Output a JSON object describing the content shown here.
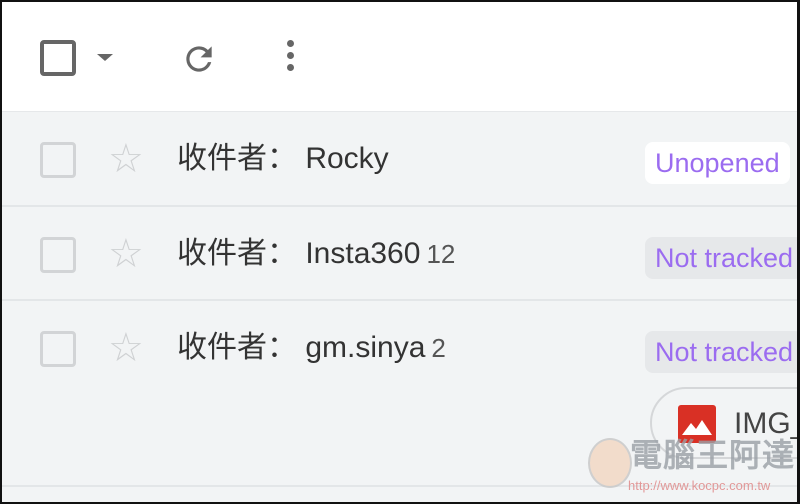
{
  "toolbar": {
    "select_icon": "checkbox-icon",
    "dropdown_icon": "caret-down-icon",
    "refresh_icon": "refresh-icon",
    "more_icon": "more-vert-icon"
  },
  "rows": [
    {
      "sender": "收件者： Rocky",
      "count": "",
      "status": "Unopened"
    },
    {
      "sender": "收件者： Insta360",
      "count": "12",
      "status": "Not tracked"
    },
    {
      "sender": "收件者： gm.sinya",
      "count": "2",
      "status": "Not tracked",
      "attachment": "IMG_"
    }
  ],
  "watermark": {
    "title": "電腦王阿達",
    "url": "http://www.kocpc.com.tw"
  },
  "colors": {
    "status_text": "#9b6cf0",
    "attachment_icon": "#d93025"
  }
}
